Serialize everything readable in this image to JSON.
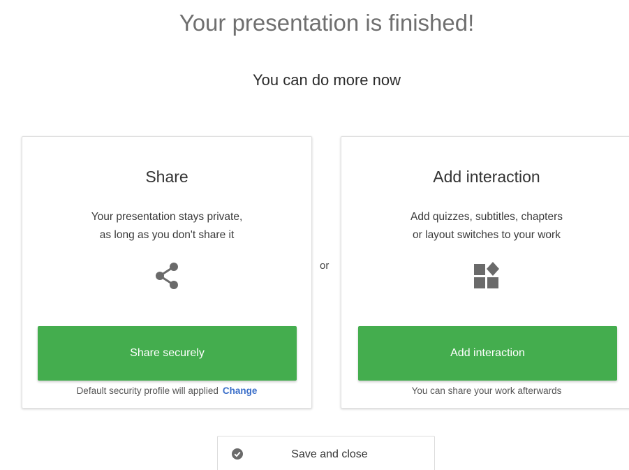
{
  "header": {
    "title": "Your presentation is finished!",
    "subtitle": "You can do more now"
  },
  "share_card": {
    "title": "Share",
    "desc_line1": "Your presentation stays private,",
    "desc_line2": "as long as you don't share it",
    "icon": "share-icon",
    "button_label": "Share securely",
    "note_text": "Default security profile will applied",
    "note_link": "Change"
  },
  "separator": "or",
  "interaction_card": {
    "title": "Add interaction",
    "desc_line1": "Add quizzes, subtitles, chapters",
    "desc_line2": "or layout switches to your work",
    "icon": "widgets-icon",
    "button_label": "Add interaction",
    "note_text": "You can share your work afterwards"
  },
  "footer": {
    "save_label": "Save and close",
    "save_icon": "check-circle-icon"
  },
  "colors": {
    "primary_button": "#44ad4e",
    "link": "#3b6fc9",
    "title_text": "#6f6f6f"
  }
}
